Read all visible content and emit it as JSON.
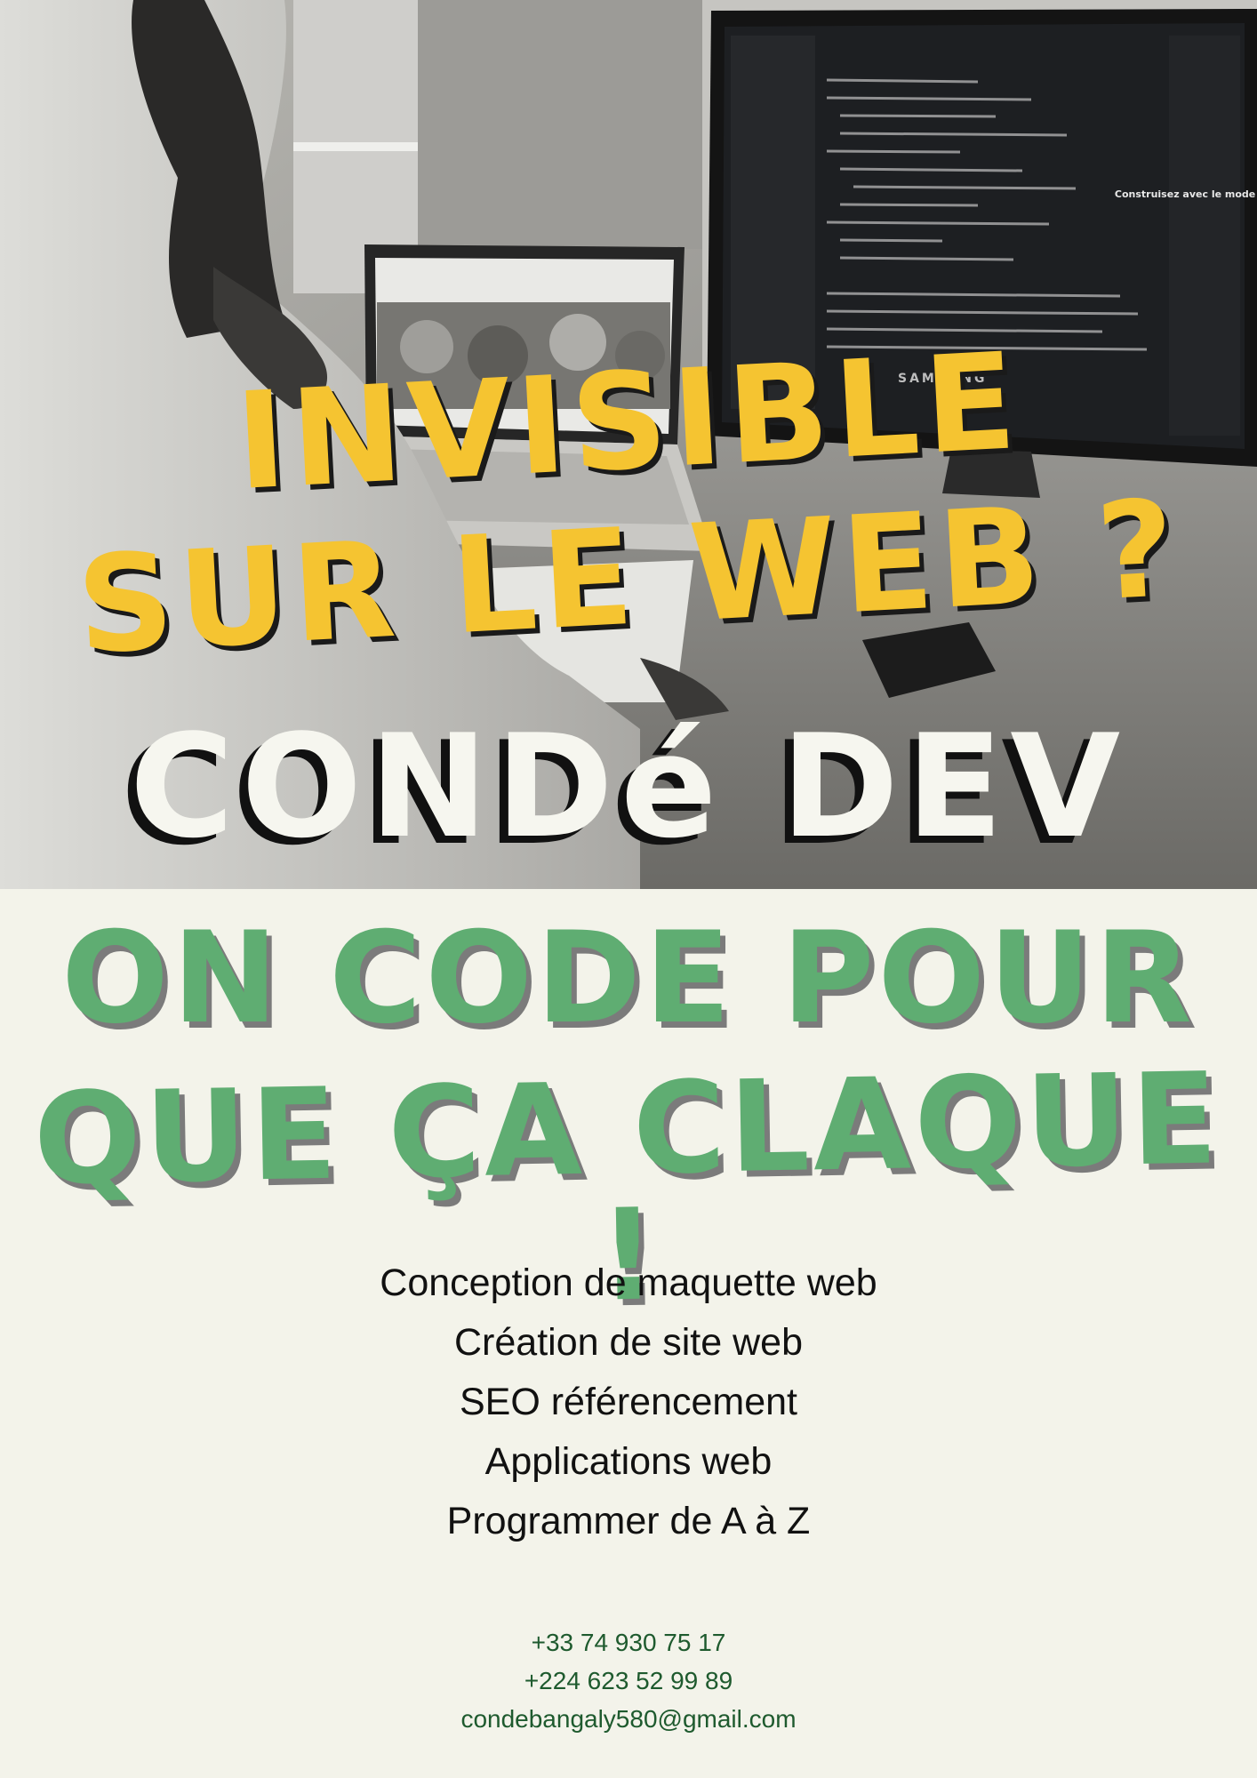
{
  "poster": {
    "headline_line1": "INVISIBLE",
    "headline_line2": "SUR LE WEB ?",
    "brand": "CONDé DEV",
    "slogan_line1": "ON CODE POUR",
    "slogan_line2": "QUE ÇA CLAQUE !",
    "services": [
      "Conception de maquette web",
      "Création de site web",
      "SEO référencement",
      "Applications web",
      "Programmer de A à Z"
    ],
    "contact": {
      "phone_fr": "+33 74 930 75 17",
      "phone_gn": "+224 623 52 99 89",
      "email": "condebangaly580@gmail.com"
    },
    "photo_screen_text": {
      "agent_title": "Construisez avec le mode agent.",
      "brand_label": "SAMSUNG"
    }
  },
  "colors": {
    "background": "#f3f3ea",
    "headline_yellow": "#f5c431",
    "slogan_green": "#5fad72",
    "contact_green": "#1e5a2e",
    "brand_white": "#f6f6ef"
  }
}
